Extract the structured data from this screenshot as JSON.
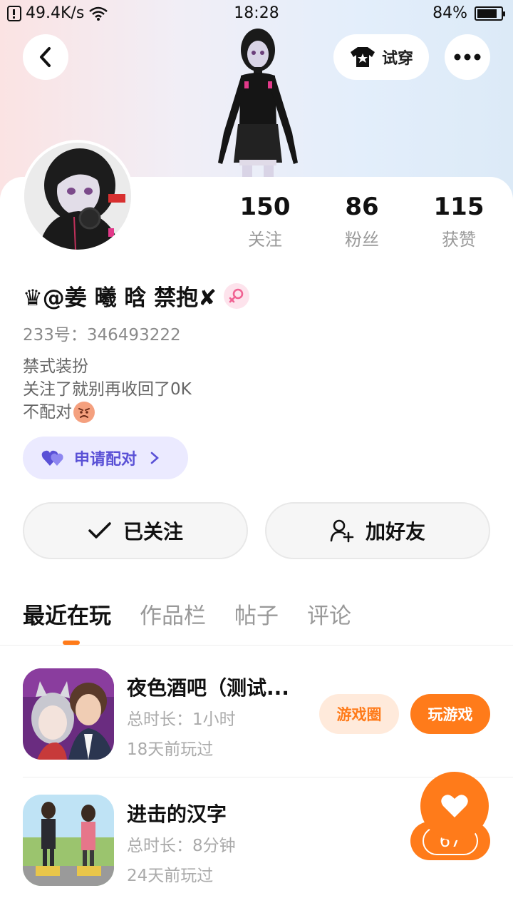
{
  "status_bar": {
    "speed": "49.4K/s",
    "time": "18:28",
    "battery": "84%",
    "battery_level": 0.84
  },
  "header": {
    "try_on_label": "试穿"
  },
  "profile": {
    "name": "♛@姜 曦 晗  禁抱✘",
    "id_line": "233号：346493222",
    "bio_lines": [
      "禁式装扮",
      "关注了就别再收回了0K",
      "不配对"
    ],
    "pair_label": "申请配对",
    "stats": [
      {
        "value": "150",
        "label": "关注"
      },
      {
        "value": "86",
        "label": "粉丝"
      },
      {
        "value": "115",
        "label": "获赞"
      }
    ]
  },
  "actions": {
    "following_label": "已关注",
    "add_friend_label": "加好友"
  },
  "tabs": [
    "最近在玩",
    "作品栏",
    "帖子",
    "评论"
  ],
  "games": [
    {
      "title": "夜色酒吧（测试...",
      "duration": "总时长：1小时",
      "last_played": "18天前玩过",
      "circle_label": "游戏圈",
      "play_label": "玩游戏"
    },
    {
      "title": "进击的汉字",
      "duration": "总时长：8分钟",
      "last_played": "24天前玩过"
    }
  ],
  "like_count": "67",
  "colors": {
    "accent": "#ff7b1a",
    "pair_bg": "#ebeaff",
    "pair_text": "#5a51d6",
    "circle_bg": "#ffeadb",
    "circle_text": "#ff7b1a"
  }
}
